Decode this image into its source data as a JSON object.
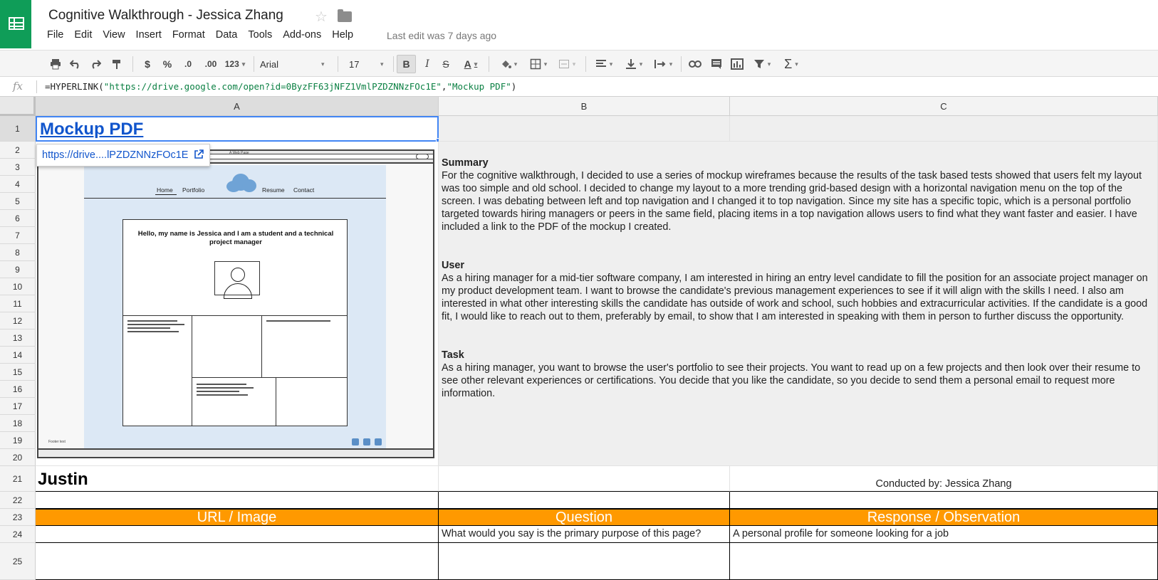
{
  "app": {
    "title": "Cognitive Walkthrough - Jessica Zhang",
    "star_icon": "☆",
    "last_edit": "Last edit was 7 days ago"
  },
  "menu": [
    "File",
    "Edit",
    "View",
    "Insert",
    "Format",
    "Data",
    "Tools",
    "Add-ons",
    "Help"
  ],
  "toolbar": {
    "print_icon": "print-icon",
    "currency": "$",
    "percent": "%",
    "decrease_decimal": ".0",
    "increase_decimal": ".00",
    "more_formats": "123",
    "font": "Arial",
    "font_size": "17",
    "bold": "B",
    "italic": "I",
    "strike": "S",
    "text_color": "A",
    "sum": "Σ"
  },
  "formula_bar": {
    "fx": "fx",
    "prefix": "=HYPERLINK(",
    "url_arg": "\"https://drive.google.com/open?id=0ByzFF63jNFZ1VmlPZDZNNzFOc1E\"",
    "comma": ",",
    "label_arg": "\"Mockup PDF\"",
    "suffix": ")"
  },
  "columns": [
    "A",
    "B",
    "C"
  ],
  "rows": [
    "1",
    "2",
    "3",
    "4",
    "5",
    "6",
    "7",
    "8",
    "9",
    "10",
    "11",
    "12",
    "13",
    "14",
    "15",
    "16",
    "17",
    "18",
    "19",
    "20",
    "21",
    "22",
    "23",
    "24",
    "25"
  ],
  "cells": {
    "a1": "Mockup PDF",
    "link_tooltip": "https://drive....lPZDZNNzFOc1E",
    "justin": "Justin",
    "conducted_by": "Conducted by: Jessica Zhang",
    "header_url": "URL / Image",
    "header_question": "Question",
    "header_response": "Response / Observation",
    "q1": "What would you say is the primary purpose of this page?",
    "r1": "A personal profile for someone looking for a job"
  },
  "notes": {
    "summary_heading": "Summary",
    "summary_text": "For the cognitive walkthrough, I decided to use a series of mockup wireframes because the results of the task based tests showed that users felt my layout was too simple and old school. I decided to change my layout to a more trending grid-based design with a horizontal navigation menu on the top of the screen. I was debating between left and top navigation and I changed it to top navigation. Since my site has a specific topic, which is a personal portfolio targeted towards hiring managers or peers in the same field, placing items in a top navigation allows users to find what they want faster and easier. I have included a link to the PDF of the mockup I created.",
    "user_heading": "User",
    "user_text": "As a hiring manager for a mid-tier software company, I am interested in hiring an entry level candidate to fill the position for an associate project manager on my product development team. I want to browse the candidate's previous management experiences to see if it will align with the skills I need. I also am interested in what other interesting skills the candidate has outside of work and school, such hobbies and extracurricular activities. If the candidate is a good fit, I would like to reach out to them, preferably by email, to show that I am interested in speaking with them in person to further discuss the opportunity.",
    "task_heading": "Task",
    "task_text": "As a hiring manager, you want to browse the user's portfolio to see their projects. You want to read up on a few projects and then look over their resume to see other relevant experiences or certifications. You decide that you like the candidate, so you decide to send them a personal email to request more information."
  },
  "mockup": {
    "tab_label": "A Web Page",
    "nav": [
      "Home",
      "Portfolio",
      "Resume",
      "Contact"
    ],
    "hello": "Hello, my name is Jessica and I am a student and a technical project manager",
    "footer": "Footer text"
  },
  "colors": {
    "brand_green": "#0f9d58",
    "header_orange": "#ff9900",
    "link_blue": "#1155cc",
    "selection_blue": "#4285f4"
  }
}
